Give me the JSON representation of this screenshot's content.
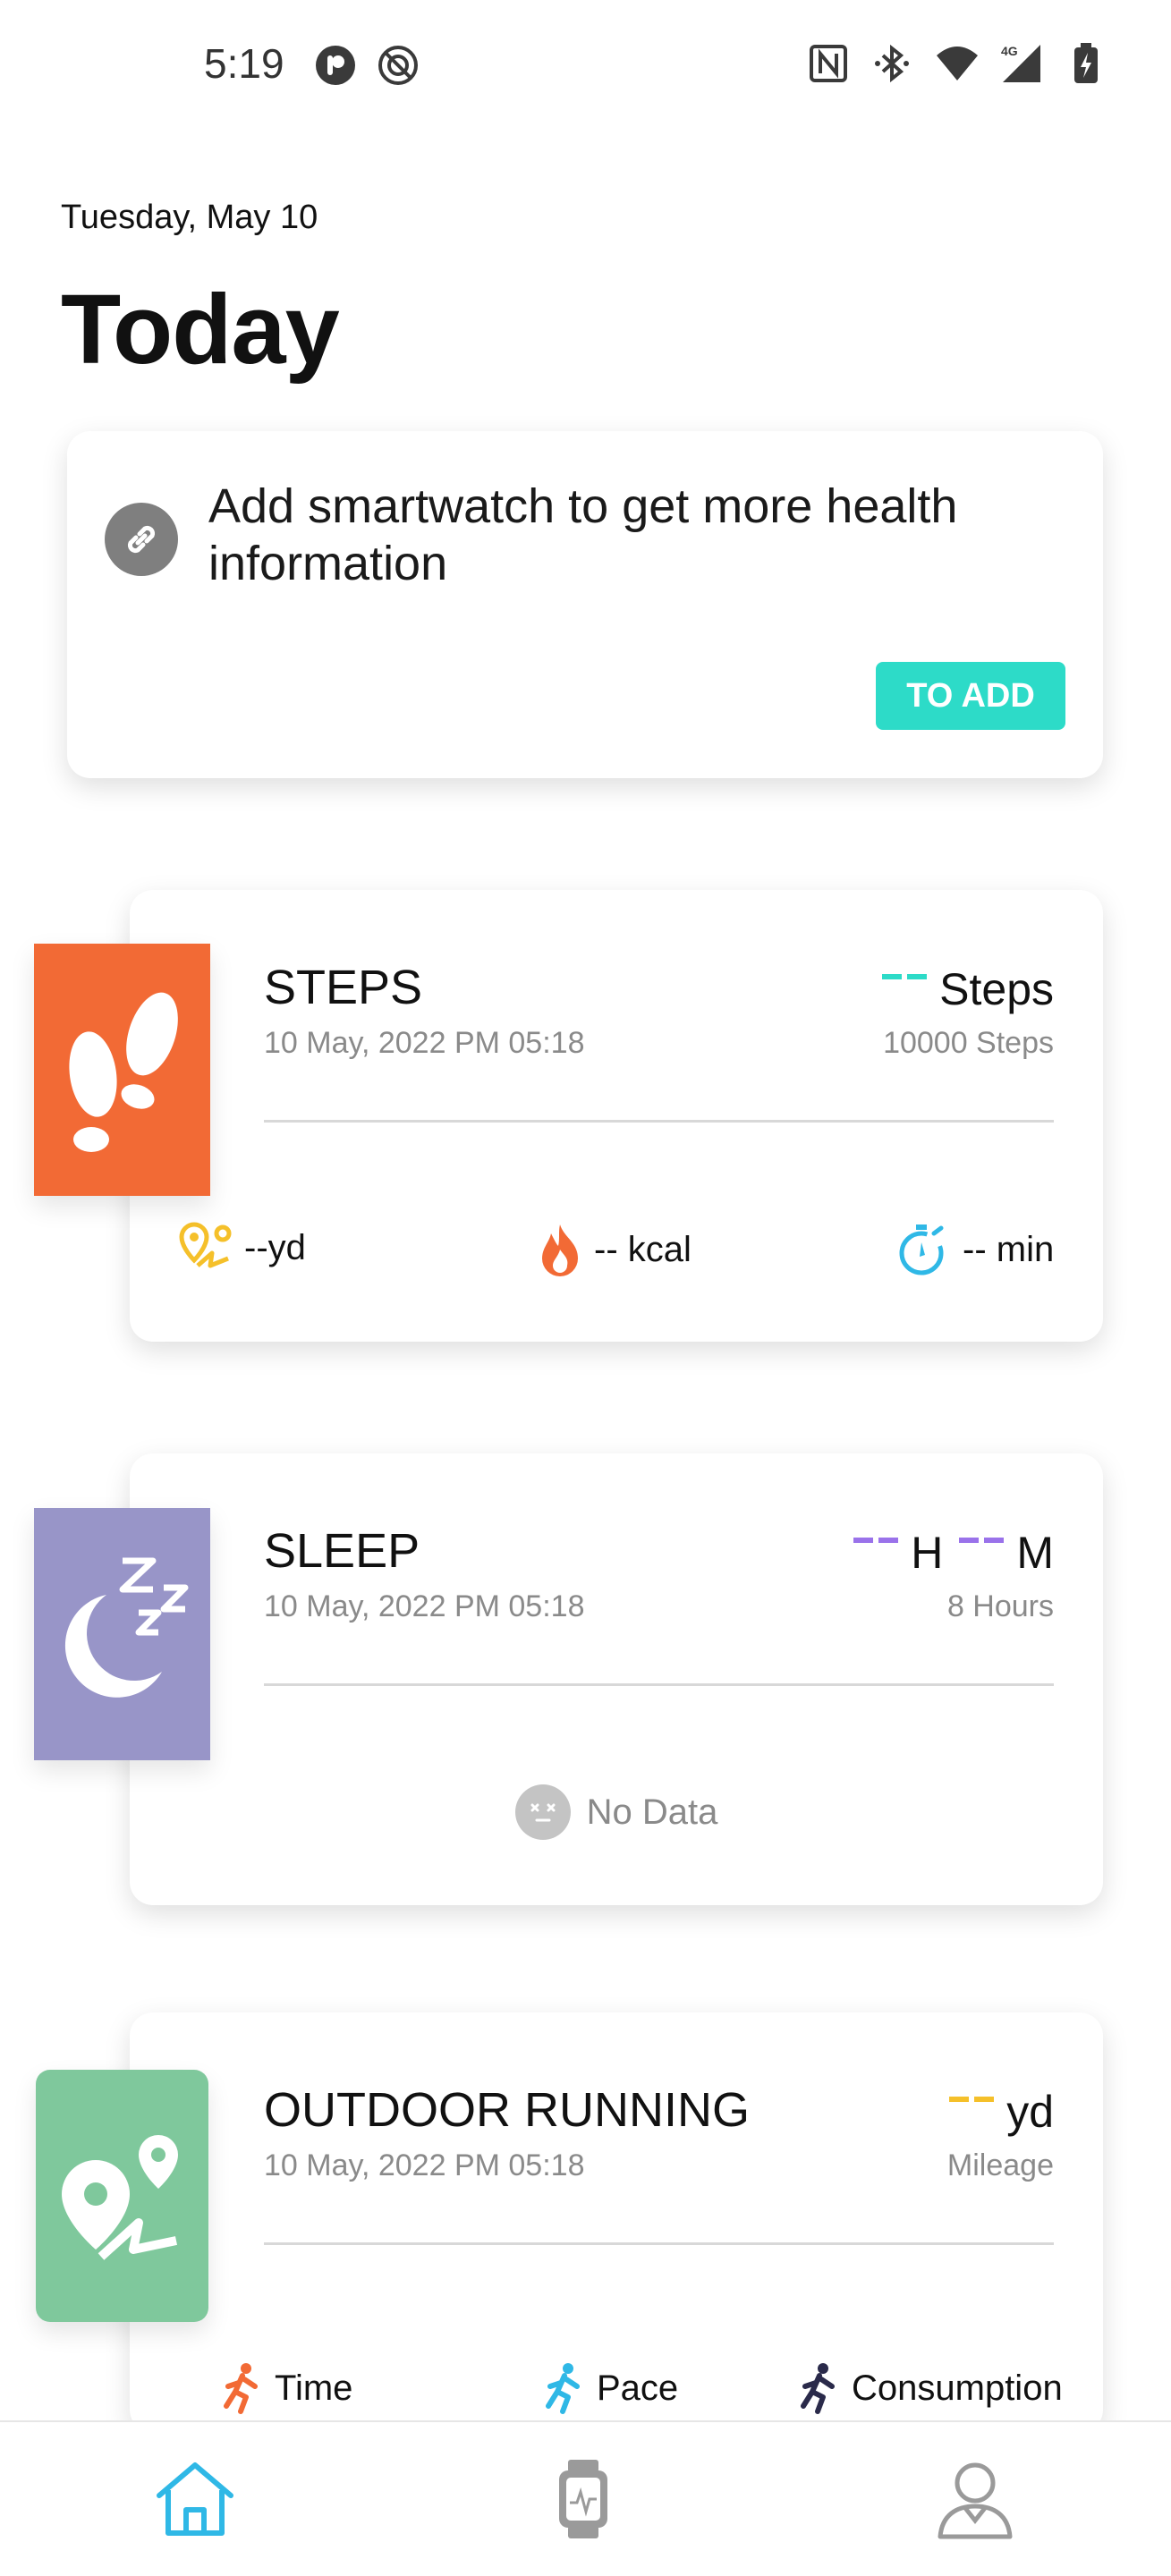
{
  "status_bar": {
    "time": "5:19",
    "left_icons": [
      "circle-p-icon",
      "no-sync-icon"
    ],
    "right_icons": [
      "nfc-icon",
      "bluetooth-icon",
      "wifi-icon",
      "signal-4g-icon",
      "battery-charging-icon"
    ],
    "network_label": "4G"
  },
  "header": {
    "date": "Tuesday, May 10",
    "title": "Today"
  },
  "add_card": {
    "message": "Add smartwatch to get more health information",
    "button_label": "TO ADD",
    "icon": "link-icon"
  },
  "steps_card": {
    "title": "STEPS",
    "timestamp": "10 May, 2022 PM 05:18",
    "value_placeholder": "--",
    "value_unit": "Steps",
    "goal": "10000 Steps",
    "tile_color": "#f26a35",
    "accent_color": "#2ddbc8",
    "stats": [
      {
        "icon": "distance-pin-icon",
        "text": "--yd",
        "color": "#f5c02a"
      },
      {
        "icon": "flame-icon",
        "text": "-- kcal",
        "color": "#f26a35"
      },
      {
        "icon": "stopwatch-icon",
        "text": "-- min",
        "color": "#2fb8e6"
      }
    ]
  },
  "sleep_card": {
    "title": "SLEEP",
    "timestamp": "10 May, 2022 PM 05:18",
    "value_placeholder_hours": "--",
    "hours_unit": "H",
    "value_placeholder_minutes": "--",
    "minutes_unit": "M",
    "goal": "8 Hours",
    "tile_color": "#9895c8",
    "accent_color": "#9a72ea",
    "no_data_label": "No Data"
  },
  "running_card": {
    "title": "OUTDOOR RUNNING",
    "timestamp": "10 May, 2022 PM 05:18",
    "value_placeholder": "--",
    "value_unit": "yd",
    "goal": "Mileage",
    "tile_color": "#7fc89c",
    "accent_color": "#f5c02a",
    "stats": [
      {
        "icon": "runner-orange-icon",
        "text": "Time",
        "color": "#f26a35"
      },
      {
        "icon": "runner-blue-icon",
        "text": "Pace",
        "color": "#2fb8e6"
      },
      {
        "icon": "runner-dark-icon",
        "text": "Consumption",
        "color": "#2a2a4a"
      }
    ]
  },
  "bottom_nav": {
    "items": [
      {
        "name": "home",
        "icon": "home-icon",
        "active": true
      },
      {
        "name": "device",
        "icon": "watch-icon",
        "active": false
      },
      {
        "name": "profile",
        "icon": "person-icon",
        "active": false
      }
    ],
    "active_color": "#2fb8e6",
    "inactive_color": "#9a9a9a"
  }
}
